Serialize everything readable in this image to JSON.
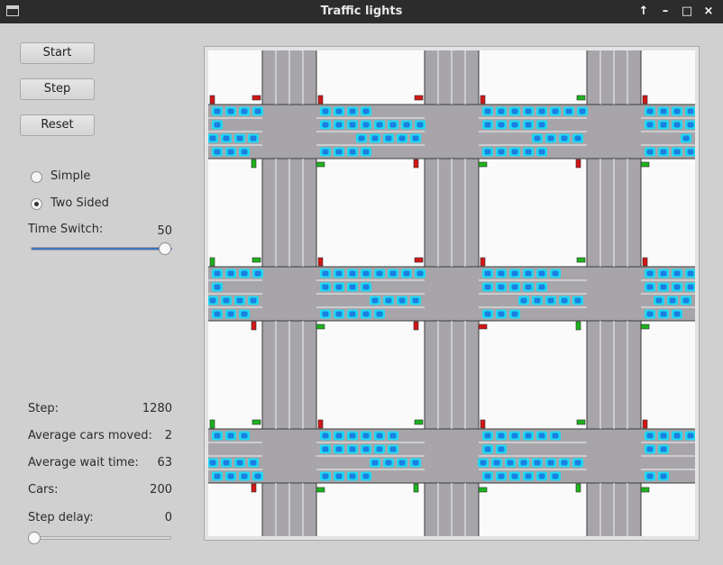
{
  "window": {
    "title": "Traffic lights",
    "buttons": [
      "↑",
      "–",
      "□",
      "×"
    ]
  },
  "controls": {
    "start_label": "Start",
    "step_label": "Step",
    "reset_label": "Reset",
    "mode_options": [
      {
        "label": "Simple",
        "selected": false
      },
      {
        "label": "Two Sided",
        "selected": true
      }
    ],
    "time_switch_label": "Time Switch:",
    "time_switch_value": "50",
    "time_switch_level": 1.0
  },
  "stats": {
    "step_label": "Step:",
    "step_value": "1280",
    "avg_moved_label": "Average cars moved:",
    "avg_moved_value": "2",
    "avg_wait_label": "Average wait time:",
    "avg_wait_value": "63",
    "cars_label": "Cars:",
    "cars_value": "200",
    "delay_label": "Step delay:",
    "delay_value": "0",
    "delay_level": 0.0
  },
  "simulation": {
    "grid_size": 3,
    "colors": {
      "road": "#a7a5a9",
      "block": "#fafafa",
      "car_body": "#1fd8f2",
      "car_core": "#1b7ee0",
      "light_red": "#d41616",
      "light_green": "#1db31d"
    },
    "car_rows": [
      [
        {
          "lanes": [
            "....",
            ".",
            "....",
            "..."
          ],
          "lights": [
            "red",
            "green"
          ]
        },
        {
          "lanes": [
            "....",
            "........",
            ".....",
            "...."
          ],
          "lights": [
            "red",
            "red"
          ]
        },
        {
          "lanes": [
            "........",
            ".....",
            "....",
            "....."
          ],
          "lights": [
            "red",
            "red"
          ]
        },
        {
          "lanes": [
            "....",
            "....",
            ".",
            "...."
          ],
          "lights": [
            "red",
            "red"
          ]
        }
      ],
      [
        {
          "lanes": [
            "....",
            ".",
            "....",
            "..."
          ],
          "lights": [
            "green",
            "red"
          ]
        },
        {
          "lanes": [
            "........",
            "....",
            "....",
            "....."
          ],
          "lights": [
            "red",
            "red"
          ]
        },
        {
          "lanes": [
            "......",
            ".....",
            ".....",
            "..."
          ],
          "lights": [
            "red",
            "green"
          ]
        },
        {
          "lanes": [
            "....",
            "....",
            "...",
            "..."
          ],
          "lights": [
            "red",
            "red"
          ]
        }
      ],
      [
        {
          "lanes": [
            "...",
            "",
            "....",
            "...."
          ],
          "lights": [
            "green",
            "red"
          ]
        },
        {
          "lanes": [
            "......",
            "......",
            "....",
            "...."
          ],
          "lights": [
            "red",
            "green"
          ]
        },
        {
          "lanes": [
            "......",
            "..",
            "........",
            "......"
          ],
          "lights": [
            "red",
            "green"
          ]
        },
        {
          "lanes": [
            "....",
            "..",
            "",
            ".."
          ],
          "lights": [
            "red",
            "red"
          ]
        }
      ]
    ]
  }
}
